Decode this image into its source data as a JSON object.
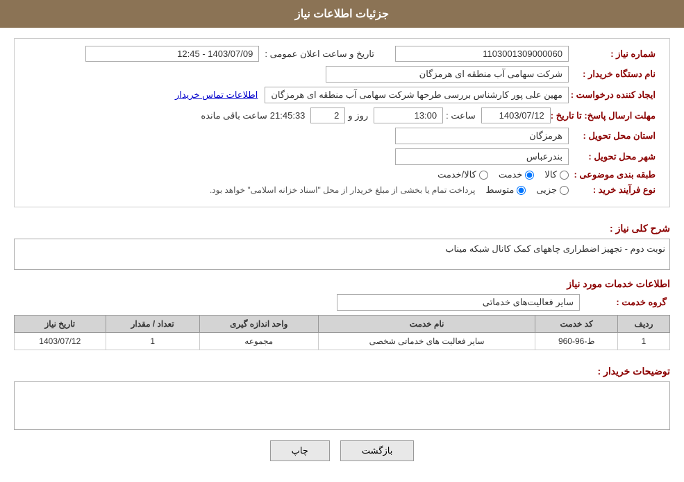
{
  "header": {
    "title": "جزئیات اطلاعات نیاز"
  },
  "fields": {
    "need_number_label": "شماره نیاز :",
    "need_number_value": "1103001309000060",
    "buyer_label": "نام دستگاه خریدار :",
    "buyer_value": "شرکت سهامی  آب منطقه ای هرمزگان",
    "creator_label": "ایجاد کننده درخواست :",
    "creator_value": "مهین علی پور کارشناس بررسی طرحها شرکت سهامی  آب منطقه ای هرمزگان",
    "contact_link": "اطلاعات تماس خریدار",
    "deadline_label": "مهلت ارسال پاسخ: تا تاریخ :",
    "deadline_date": "1403/07/12",
    "deadline_time_label": "ساعت :",
    "deadline_time": "13:00",
    "deadline_days_label": "روز و",
    "deadline_days": "2",
    "deadline_remaining_label": "ساعت باقی مانده",
    "deadline_remaining": "21:45:33",
    "province_label": "استان محل تحویل :",
    "province_value": "هرمزگان",
    "city_label": "شهر محل تحویل :",
    "city_value": "بندرعباس",
    "category_label": "طبقه بندی موضوعی :",
    "category_options": [
      "کالا",
      "خدمت",
      "کالا/خدمت"
    ],
    "category_selected": "خدمت",
    "process_label": "نوع فرآیند خرید :",
    "process_options": [
      "جزیی",
      "متوسط"
    ],
    "process_note": "پرداخت تمام یا بخشی از مبلغ خریدار از محل \"اسناد خزانه اسلامی\" خواهد بود.",
    "announce_label": "تاریخ و ساعت اعلان عمومی :",
    "announce_value": "1403/07/09 - 12:45"
  },
  "need_description": {
    "section_title": "شرح کلی نیاز :",
    "value": "نوبت دوم - تجهیز اضطراری چاههای کمک کانال شبکه میناب"
  },
  "services_info": {
    "section_title": "اطلاعات خدمات مورد نیاز",
    "group_label": "گروه خدمت :",
    "group_value": "سایر فعالیت‌های خدماتی",
    "table_headers": [
      "ردیف",
      "کد خدمت",
      "نام خدمت",
      "واحد اندازه گیری",
      "تعداد / مقدار",
      "تاریخ نیاز"
    ],
    "table_rows": [
      {
        "row": "1",
        "code": "ط-96-960",
        "name": "سایر فعالیت های خدماتی شخصی",
        "unit": "مجموعه",
        "quantity": "1",
        "date": "1403/07/12"
      }
    ]
  },
  "buyer_notes": {
    "label": "توضیحات خریدار :",
    "value": ""
  },
  "buttons": {
    "print": "چاپ",
    "back": "بازگشت"
  }
}
